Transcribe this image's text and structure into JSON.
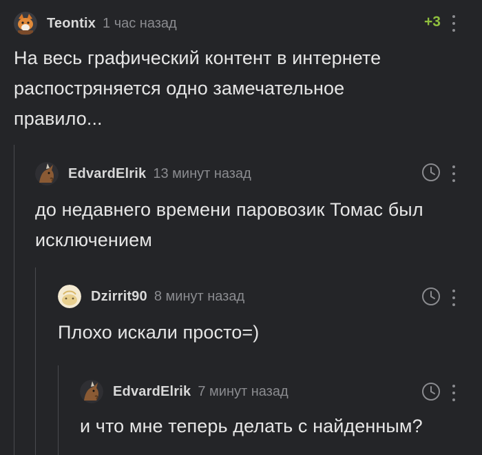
{
  "comments": [
    {
      "username": "Teontix",
      "time": "1 час назад",
      "rating": "+3",
      "text": [
        "На весь графический контент в интернете",
        "распостряняется одно замечательное",
        "правило..."
      ]
    },
    {
      "username": "EdvardElrik",
      "time": "13 минут назад",
      "text": [
        "до недавнего времени паровозик Томас был",
        "исключением"
      ]
    },
    {
      "username": "Dzirrit90",
      "time": "8 минут назад",
      "text": [
        "Плохо искали просто=)"
      ]
    },
    {
      "username": "EdvardElrik",
      "time": "7 минут назад",
      "text": [
        "и что мне теперь делать с найденным?"
      ]
    }
  ],
  "colors": {
    "background": "#242528",
    "rating_positive": "#8fbf3e",
    "muted": "#8b8c90",
    "thread_line": "#4a4b4f"
  },
  "icons": [
    "more-icon",
    "clock-icon"
  ]
}
